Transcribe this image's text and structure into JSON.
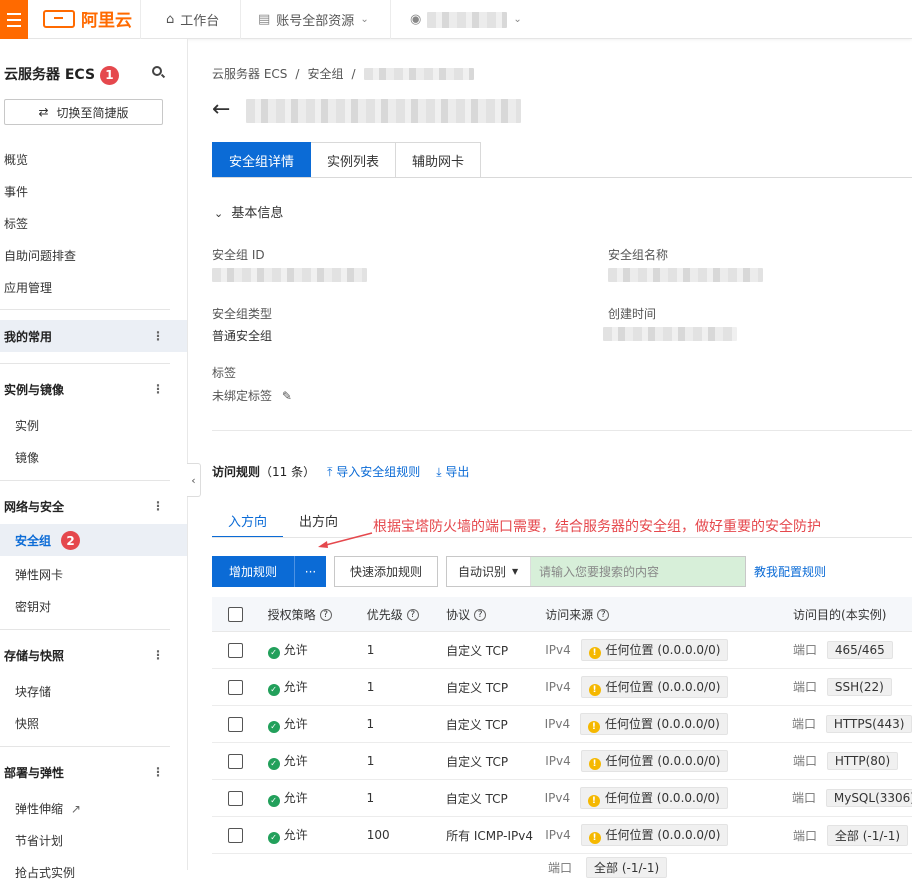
{
  "topbar": {
    "logo_text": "阿里云",
    "workbench": "工作台",
    "resources": "账号全部资源"
  },
  "sidebar": {
    "title": "云服务器 ECS",
    "title_badge": "1",
    "switch_label": "切换至简捷版",
    "top_items": [
      "概览",
      "事件",
      "标签",
      "自助问题排查",
      "应用管理"
    ],
    "favorites": "我的常用",
    "group_instances": "实例与镜像",
    "instances_items": [
      "实例",
      "镜像"
    ],
    "group_network": "网络与安全",
    "network_items": [
      "安全组",
      "弹性网卡",
      "密钥对"
    ],
    "network_badge": "2",
    "group_storage": "存储与快照",
    "storage_items": [
      "块存储",
      "快照"
    ],
    "group_deploy": "部署与弹性",
    "deploy_items": [
      "弹性伸缩",
      "节省计划",
      "抢占式实例"
    ]
  },
  "main": {
    "breadcrumb": [
      "云服务器 ECS",
      "安全组"
    ],
    "tabs": [
      "安全组详情",
      "实例列表",
      "辅助网卡"
    ],
    "basic_info_title": "基本信息",
    "fields": {
      "id_label": "安全组 ID",
      "name_label": "安全组名称",
      "type_label": "安全组类型",
      "type_value": "普通安全组",
      "created_label": "创建时间",
      "tags_label": "标签",
      "tags_value": "未绑定标签"
    },
    "rules": {
      "title": "访问规则",
      "count": "（11 条）",
      "import_label": "导入安全组规则",
      "export_label": "导出"
    },
    "direction_tabs": [
      "入方向",
      "出方向"
    ],
    "annotation": "根据宝塔防火墙的端口需要，结合服务器的安全组，做好重要的安全防护",
    "toolbar": {
      "add_rule": "增加规则",
      "more": "···",
      "quick_add": "快速添加规则",
      "auto_detect": "自动识别",
      "search_placeholder": "请输入您要搜索的内容",
      "help": "教我配置规则"
    },
    "table": {
      "headers": [
        "授权策略",
        "优先级",
        "协议",
        "访问来源",
        "访问目的(本实例)"
      ],
      "rows": [
        {
          "policy": "允许",
          "priority": "1",
          "protocol": "自定义 TCP",
          "src_type": "IPv4",
          "src": "任何位置 (0.0.0.0/0)",
          "dst_type": "端口",
          "dst": "465/465"
        },
        {
          "policy": "允许",
          "priority": "1",
          "protocol": "自定义 TCP",
          "src_type": "IPv4",
          "src": "任何位置 (0.0.0.0/0)",
          "dst_type": "端口",
          "dst": "SSH(22)"
        },
        {
          "policy": "允许",
          "priority": "1",
          "protocol": "自定义 TCP",
          "src_type": "IPv4",
          "src": "任何位置 (0.0.0.0/0)",
          "dst_type": "端口",
          "dst": "HTTPS(443)"
        },
        {
          "policy": "允许",
          "priority": "1",
          "protocol": "自定义 TCP",
          "src_type": "IPv4",
          "src": "任何位置 (0.0.0.0/0)",
          "dst_type": "端口",
          "dst": "HTTP(80)"
        },
        {
          "policy": "允许",
          "priority": "1",
          "protocol": "自定义 TCP",
          "src_type": "IPv4",
          "src": "任何位置 (0.0.0.0/0)",
          "dst_type": "端口",
          "dst": "MySQL(3306)"
        },
        {
          "policy": "允许",
          "priority": "100",
          "protocol": "所有 ICMP-IPv4",
          "src_type": "IPv4",
          "src": "任何位置 (0.0.0.0/0)",
          "dst_type": "端口",
          "dst": "全部 (-1/-1)"
        }
      ],
      "extra_row": {
        "label": "端口",
        "value": "全部 (-1/-1)"
      }
    }
  }
}
